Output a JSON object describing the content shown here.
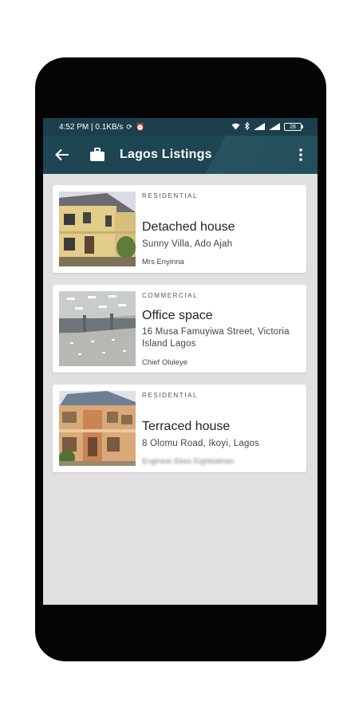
{
  "status_bar": {
    "time_info": "4:52 PM | 0.1KB/s",
    "icons": [
      "sync-icon",
      "alarm-icon",
      "wifi-icon",
      "bluetooth-icon",
      "signal-icon",
      "signal-icon"
    ],
    "battery": "28"
  },
  "app_bar": {
    "title": "Lagos Listings",
    "back_icon": "arrow-left-icon",
    "app_icon": "briefcase-icon",
    "menu_icon": "more-vertical-icon",
    "color": "#1d4652"
  },
  "listings": [
    {
      "category": "RESIDENTIAL",
      "title": "Detached house",
      "address": "Sunny Villa, Ado Ajah",
      "agent": "Mrs Enyinna",
      "image": "detached-house-photo"
    },
    {
      "category": "COMMERCIAL",
      "title": "Office space",
      "address": "16 Musa Famuyiwa Street, Victoria Island Lagos",
      "agent": "Chief Oluleye",
      "image": "office-space-photo"
    },
    {
      "category": "RESIDENTIAL",
      "title": "Terraced house",
      "address": "8 Olomu Road, Ikoyi, Lagos",
      "agent": "Engineer Ekeo Eighbokhan",
      "image": "terraced-house-photo"
    }
  ]
}
